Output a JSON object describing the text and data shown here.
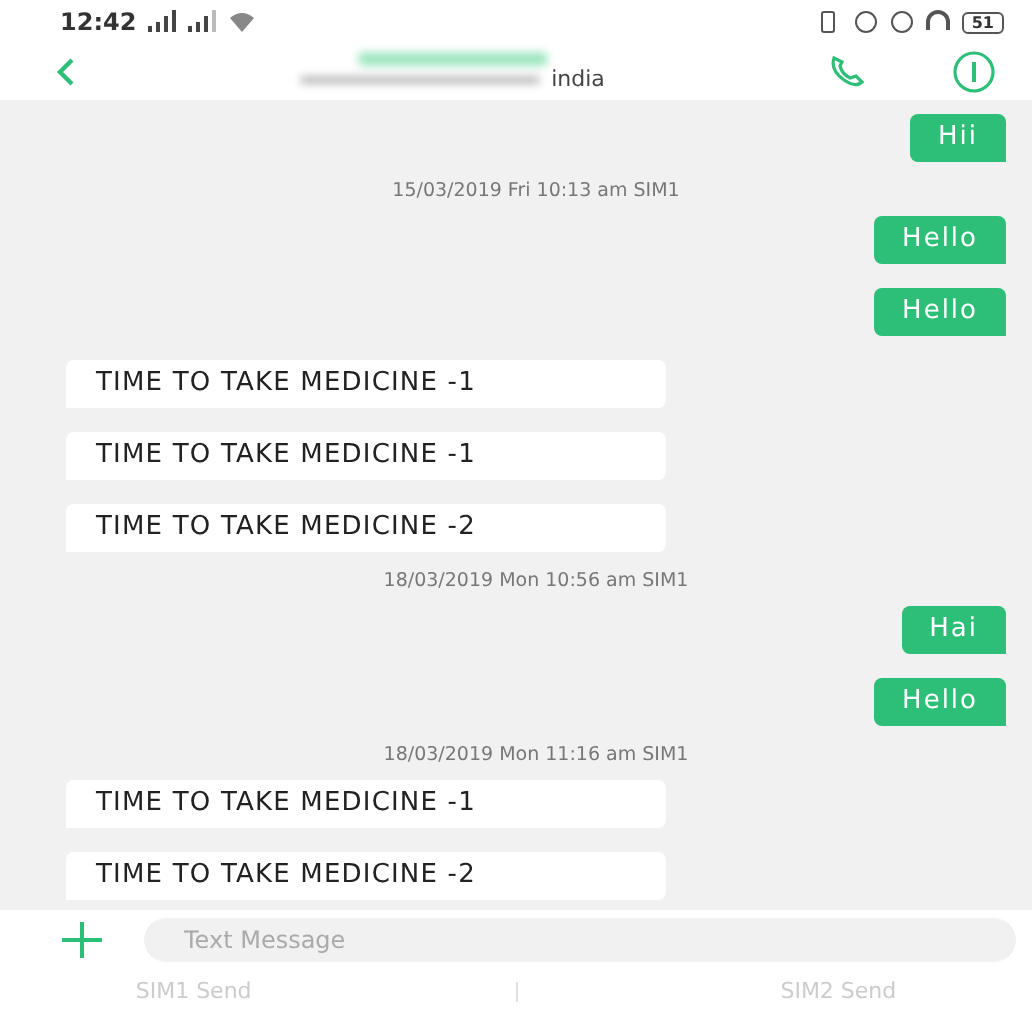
{
  "status_bar": {
    "time": "12:42",
    "battery": "51"
  },
  "header": {
    "subtitle": "india"
  },
  "messages": [
    {
      "kind": "sent",
      "text": "Hii"
    },
    {
      "kind": "timestamp",
      "text": "15/03/2019 Fri 10:13 am  SIM1"
    },
    {
      "kind": "sent",
      "text": "Hello"
    },
    {
      "kind": "sent",
      "text": "Hello"
    },
    {
      "kind": "received",
      "text": "TIME TO TAKE MEDICINE -1"
    },
    {
      "kind": "received",
      "text": "TIME TO TAKE MEDICINE -1"
    },
    {
      "kind": "received",
      "text": "TIME TO TAKE MEDICINE -2"
    },
    {
      "kind": "timestamp",
      "text": "18/03/2019 Mon 10:56 am  SIM1"
    },
    {
      "kind": "sent",
      "text": "Hai"
    },
    {
      "kind": "sent",
      "text": "Hello"
    },
    {
      "kind": "timestamp",
      "text": "18/03/2019 Mon 11:16 am  SIM1"
    },
    {
      "kind": "received",
      "text": "TIME TO TAKE MEDICINE -1"
    },
    {
      "kind": "received",
      "text": "TIME TO TAKE MEDICINE -2"
    }
  ],
  "composer": {
    "placeholder": "Text Message"
  },
  "send_buttons": [
    "SIM1 Send",
    "SIM2 Send"
  ]
}
